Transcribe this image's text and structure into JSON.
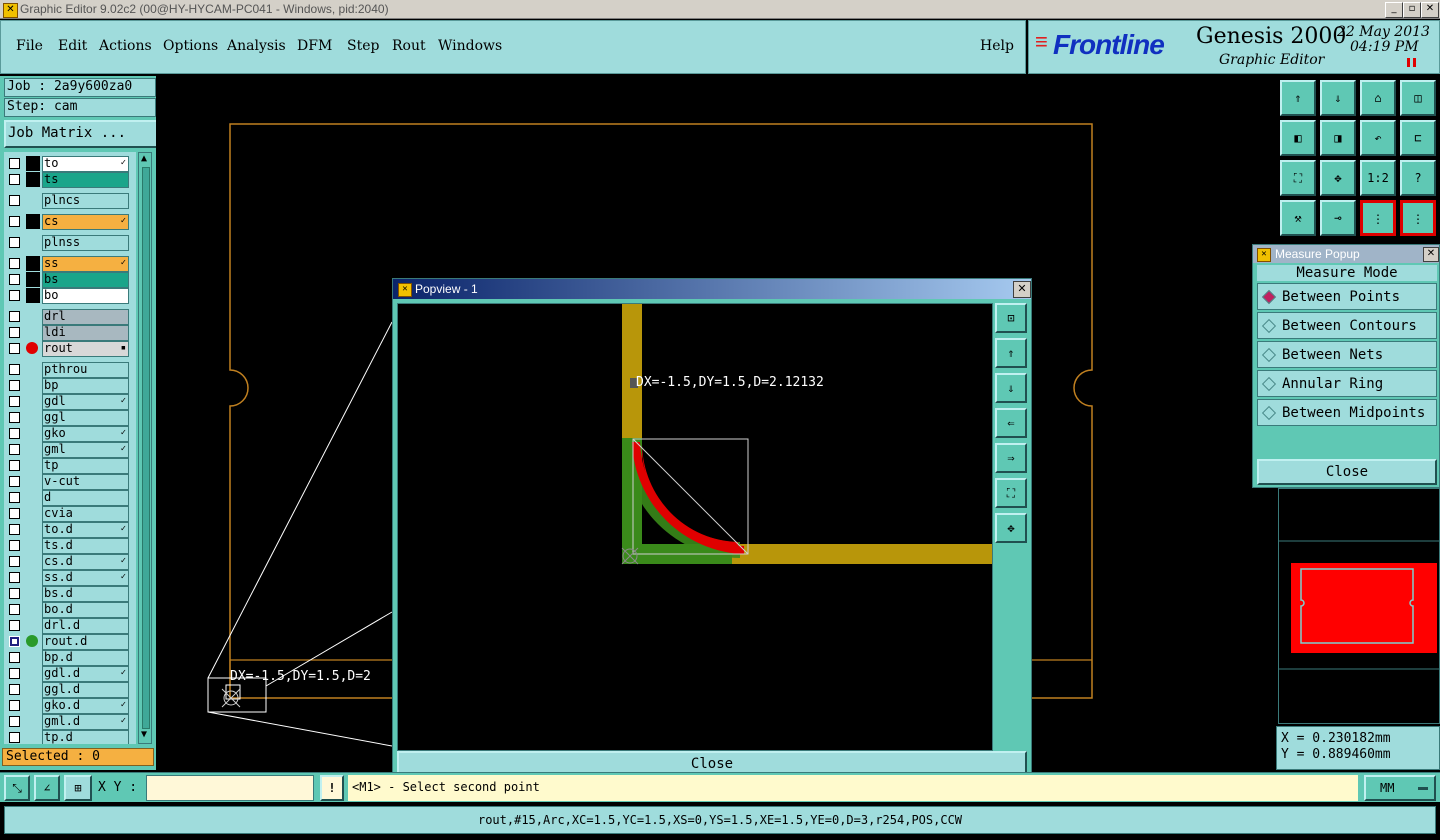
{
  "window": {
    "title": "Graphic Editor 9.02c2 (00@HY-HYCAM-PC041 - Windows, pid:2040)",
    "minimize": "_",
    "maximize": "▫",
    "close": "✕"
  },
  "menu": {
    "items": [
      "File",
      "Edit",
      "Actions",
      "Options",
      "Analysis",
      "DFM",
      "Step",
      "Rout",
      "Windows"
    ],
    "help": "Help"
  },
  "brand": {
    "logo": "Frontline",
    "product": "Genesis 2000",
    "subtitle": "Graphic Editor",
    "date": "22 May 2013",
    "time": "04:19 PM"
  },
  "job": {
    "job_label": "Job : 2a9y600za0",
    "step_label": "Step: cam",
    "matrix_button": "Job Matrix ..."
  },
  "layers": [
    {
      "name": "to",
      "color": "#ffffff",
      "flag": "✓",
      "black": true
    },
    {
      "name": "ts",
      "color": "#1aa58a",
      "flag": "",
      "black": true
    },
    {
      "name": "plncs",
      "color": "#9fdcdc",
      "flag": "",
      "black": false,
      "gap": true
    },
    {
      "name": "cs",
      "color": "#f5b041",
      "flag": "✓",
      "black": true,
      "gap": true
    },
    {
      "name": "plnss",
      "color": "#9fdcdc",
      "flag": "",
      "black": false,
      "gap": true
    },
    {
      "name": "ss",
      "color": "#f5b041",
      "flag": "✓",
      "black": true,
      "gap": true
    },
    {
      "name": "bs",
      "color": "#1aa58a",
      "flag": "",
      "black": true
    },
    {
      "name": "bo",
      "color": "#ffffff",
      "flag": "",
      "black": true
    },
    {
      "name": "drl",
      "color": "#a8b8c0",
      "flag": "",
      "black": false,
      "gap": true
    },
    {
      "name": "ldi",
      "color": "#a8b8c0",
      "flag": "",
      "black": false
    },
    {
      "name": "rout",
      "color": "#d8d8d8",
      "flag": "▪",
      "black": false,
      "dot": "#e00000"
    },
    {
      "name": "pthrou",
      "color": "#9fdcdc",
      "flag": "",
      "black": false,
      "gap": true
    },
    {
      "name": "bp",
      "color": "#9fdcdc",
      "flag": "",
      "black": false
    },
    {
      "name": "gdl",
      "color": "#9fdcdc",
      "flag": "✓",
      "black": false
    },
    {
      "name": "ggl",
      "color": "#9fdcdc",
      "flag": "",
      "black": false
    },
    {
      "name": "gko",
      "color": "#9fdcdc",
      "flag": "✓",
      "black": false
    },
    {
      "name": "gml",
      "color": "#9fdcdc",
      "flag": "✓",
      "black": false
    },
    {
      "name": "tp",
      "color": "#9fdcdc",
      "flag": "",
      "black": false
    },
    {
      "name": "v-cut",
      "color": "#9fdcdc",
      "flag": "",
      "black": false
    },
    {
      "name": "d",
      "color": "#9fdcdc",
      "flag": "",
      "black": false
    },
    {
      "name": "cvia",
      "color": "#9fdcdc",
      "flag": "",
      "black": false
    },
    {
      "name": "to.d",
      "color": "#9fdcdc",
      "flag": "✓",
      "black": false
    },
    {
      "name": "ts.d",
      "color": "#9fdcdc",
      "flag": "",
      "black": false
    },
    {
      "name": "cs.d",
      "color": "#9fdcdc",
      "flag": "✓",
      "black": false
    },
    {
      "name": "ss.d",
      "color": "#9fdcdc",
      "flag": "✓",
      "black": false
    },
    {
      "name": "bs.d",
      "color": "#9fdcdc",
      "flag": "",
      "black": false
    },
    {
      "name": "bo.d",
      "color": "#9fdcdc",
      "flag": "",
      "black": false
    },
    {
      "name": "drl.d",
      "color": "#9fdcdc",
      "flag": "",
      "black": false
    },
    {
      "name": "rout.d",
      "color": "#9fdcdc",
      "flag": "",
      "black": false,
      "dot": "#2a9a2a",
      "navy": true
    },
    {
      "name": "bp.d",
      "color": "#9fdcdc",
      "flag": "",
      "black": false
    },
    {
      "name": "gdl.d",
      "color": "#9fdcdc",
      "flag": "✓",
      "black": false
    },
    {
      "name": "ggl.d",
      "color": "#9fdcdc",
      "flag": "",
      "black": false
    },
    {
      "name": "gko.d",
      "color": "#9fdcdc",
      "flag": "✓",
      "black": false
    },
    {
      "name": "gml.d",
      "color": "#9fdcdc",
      "flag": "✓",
      "black": false
    },
    {
      "name": "tp.d",
      "color": "#9fdcdc",
      "flag": "",
      "black": false
    }
  ],
  "selected": "Selected : 0",
  "canvas": {
    "measure_text": "DX=-1.5,DY=1.5,D=2"
  },
  "toolbar": {
    "buttons": [
      "home-up",
      "home-down",
      "home",
      "window",
      "left",
      "right",
      "undo",
      "ruler",
      "fit",
      "center",
      "1:2",
      "?",
      "wrench",
      "probe",
      "layers-red",
      "layers-blue"
    ],
    "labels": {
      "ratio": "1:2",
      "help": "?"
    }
  },
  "measure_popup": {
    "title": "Measure Popup",
    "mode_label": "Measure Mode",
    "options": [
      "Between Points",
      "Between Contours",
      "Between Nets",
      "Annular Ring",
      "Between Midpoints"
    ],
    "selected_index": 0,
    "close": "Close"
  },
  "popview": {
    "title": "Popview - 1",
    "measure_text": "DX=-1.5,DY=1.5,D=2.12132",
    "close": "Close"
  },
  "readout": {
    "x": "X = 0.230182mm",
    "y": "Y = 0.889460mm"
  },
  "bottom": {
    "xy_label": "X Y :",
    "xy_value": "",
    "prompt": "<M1> - Select second point",
    "units": "MM",
    "alert": "!"
  },
  "command_line": "rout,#15,Arc,XC=1.5,YC=1.5,XS=0,YS=1.5,XE=1.5,YE=0,D=3,r254,POS,CCW",
  "colors": {
    "panel": "#5fc8b4",
    "panel_light": "#9fdcdc",
    "trace_yellow": "#b8960a",
    "trace_green": "#3a8a1a",
    "highlight_red": "#e00000",
    "outline": "#c08020"
  }
}
